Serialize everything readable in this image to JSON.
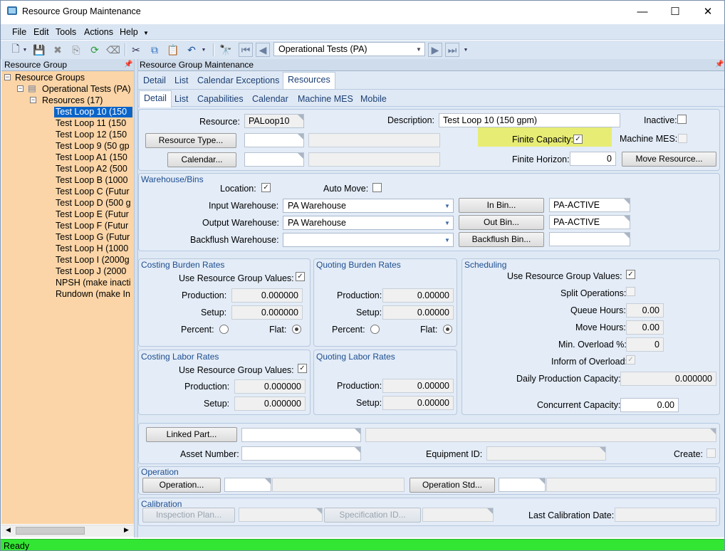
{
  "window": {
    "title": "Resource Group Maintenance",
    "controls": {
      "minimize": "—",
      "maximize": "☐",
      "close": "✕"
    }
  },
  "menu": [
    "File",
    "Edit",
    "Tools",
    "Actions",
    "Help"
  ],
  "toolbar": {
    "company": "Operational Tests (PA)"
  },
  "left": {
    "header": "Resource Group",
    "tree": {
      "root": "Resource Groups",
      "group": "Operational Tests (PA)",
      "folder": "Resources (17)",
      "items": [
        "Test Loop 10 (150",
        "Test Loop 11 (150",
        "Test Loop 12 (150",
        "Test Loop 9 (50 gp",
        "Test Loop A1 (150",
        "Test Loop A2 (500",
        "Test Loop B (1000",
        "Test Loop C (Futur",
        "Test Loop D (500 g",
        "Test Loop E (Futur",
        "Test Loop F (Futur",
        "Test Loop G (Futur",
        "Test Loop H (1000",
        "Test Loop I (2000g",
        "Test Loop J (2000",
        "NPSH (make inacti",
        "Rundown (make In"
      ]
    }
  },
  "right": {
    "header": "Resource Group Maintenance",
    "tabs": [
      "Detail",
      "List",
      "Calendar Exceptions",
      "Resources"
    ],
    "subtabs": [
      "Detail",
      "List",
      "Capabilities",
      "Calendar",
      "Machine MES",
      "Mobile"
    ]
  },
  "form": {
    "resource_label": "Resource:",
    "resource_value": "PALoop10",
    "description_label": "Description:",
    "description_value": "Test Loop 10 (150 gpm)",
    "inactive_label": "Inactive:",
    "resource_type_btn": "Resource Type...",
    "calendar_btn": "Calendar...",
    "finite_capacity_label": "Finite Capacity:",
    "machine_mes_label": "Machine MES:",
    "finite_horizon_label": "Finite Horizon:",
    "finite_horizon_value": "0",
    "move_resource_btn": "Move Resource..."
  },
  "warehouse": {
    "title": "Warehouse/Bins",
    "location_label": "Location:",
    "auto_move_label": "Auto Move:",
    "input_label": "Input Warehouse:",
    "input_value": "PA Warehouse",
    "in_bin_btn": "In Bin...",
    "in_bin_value": "PA-ACTIVE",
    "output_label": "Output Warehouse:",
    "output_value": "PA Warehouse",
    "out_bin_btn": "Out Bin...",
    "out_bin_value": "PA-ACTIVE",
    "backflush_label": "Backflush Warehouse:",
    "backflush_bin_btn": "Backflush Bin..."
  },
  "costing_burden": {
    "title": "Costing Burden Rates",
    "use_label": "Use Resource Group Values:",
    "production_label": "Production:",
    "production": "0.000000",
    "setup_label": "Setup:",
    "setup": "0.000000",
    "percent_label": "Percent:",
    "flat_label": "Flat:"
  },
  "quoting_burden": {
    "title": "Quoting Burden Rates",
    "production_label": "Production:",
    "production": "0.00000",
    "setup_label": "Setup:",
    "setup": "0.00000",
    "percent_label": "Percent:",
    "flat_label": "Flat:"
  },
  "costing_labor": {
    "title": "Costing Labor Rates",
    "use_label": "Use Resource Group Values:",
    "production_label": "Production:",
    "production": "0.000000",
    "setup_label": "Setup:",
    "setup": "0.000000"
  },
  "quoting_labor": {
    "title": "Quoting Labor Rates",
    "production_label": "Production:",
    "production": "0.00000",
    "setup_label": "Setup:",
    "setup": "0.00000"
  },
  "scheduling": {
    "title": "Scheduling",
    "use_label": "Use Resource Group Values:",
    "split_label": "Split Operations:",
    "queue_label": "Queue Hours:",
    "queue": "0.00",
    "move_label": "Move Hours:",
    "move": "0.00",
    "overload_label": "Min. Overload %:",
    "overload": "0",
    "inform_label": "Inform of Overload:",
    "daily_label": "Daily Production Capacity:",
    "daily": "0.000000",
    "concurrent_label": "Concurrent Capacity:",
    "concurrent": "0.00"
  },
  "linked": {
    "linked_part_btn": "Linked Part...",
    "asset_label": "Asset Number:",
    "equipment_label": "Equipment ID:",
    "create_label": "Create:"
  },
  "operation": {
    "title": "Operation",
    "operation_btn": "Operation...",
    "operation_std_btn": "Operation Std..."
  },
  "calibration": {
    "title": "Calibration",
    "inspection_btn": "Inspection Plan...",
    "spec_btn": "Specification ID...",
    "last_label": "Last Calibration Date:"
  },
  "status": "Ready",
  "colors": {
    "tree_bg": "#fbd5a7",
    "highlight": "#e7ec5e",
    "status_bg": "#33e633",
    "selection": "#0a64c8"
  }
}
